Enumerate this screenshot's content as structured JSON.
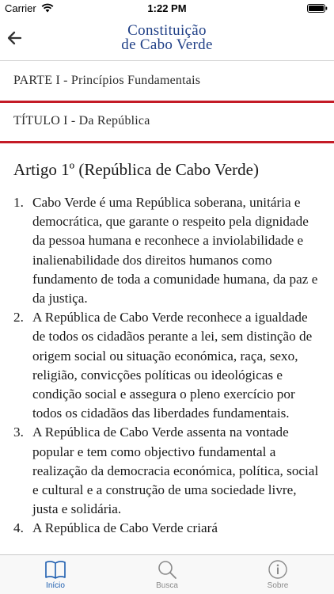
{
  "status_bar": {
    "carrier": "Carrier",
    "time": "1:22 PM",
    "icons": [
      "wifi-icon",
      "battery-icon"
    ]
  },
  "nav": {
    "back_icon": "arrow-left-icon",
    "title_line1": "Constituição",
    "title_line2": "de Cabo Verde",
    "title_color": "#1f3f86"
  },
  "hierarchy": {
    "part": "PARTE I - Princípios Fundamentais",
    "title": "TÍTULO I - Da República",
    "rule_color": "#c41b26"
  },
  "article": {
    "heading": "Artigo 1º (República de Cabo Verde)",
    "items": [
      {
        "number": "1.",
        "text": "Cabo Verde é uma República soberana, unitária e democrática, que garante o respeito pela dignidade da pessoa humana e reconhece a inviolabilidade e inalienabilidade dos direitos humanos como fundamento de toda a comunidade humana, da paz e da justiça."
      },
      {
        "number": "2.",
        "text": "A República de Cabo Verde reconhece a igualdade de todos os cidadãos perante a lei, sem distinção de origem social ou situação económica, raça, sexo, religião, convicções políticas ou ideológicas e condição social e assegura o pleno exercício por todos os cidadãos das liberdades fundamentais."
      },
      {
        "number": "3.",
        "text": "A República de Cabo Verde assenta na vontade popular e tem como objectivo fundamental a realização da democracia económica, política, social e cultural e a construção de uma sociedade livre, justa e solidária."
      },
      {
        "number": "4.",
        "text": "A República de Cabo Verde criará"
      }
    ]
  },
  "tabs": [
    {
      "label": "Início",
      "icon": "book-icon",
      "active": true
    },
    {
      "label": "Busca",
      "icon": "search-icon",
      "active": false
    },
    {
      "label": "Sobre",
      "icon": "info-icon",
      "active": false
    }
  ],
  "colors": {
    "tab_active": "#1f5fb0",
    "tab_inactive": "#8a8a8a"
  }
}
